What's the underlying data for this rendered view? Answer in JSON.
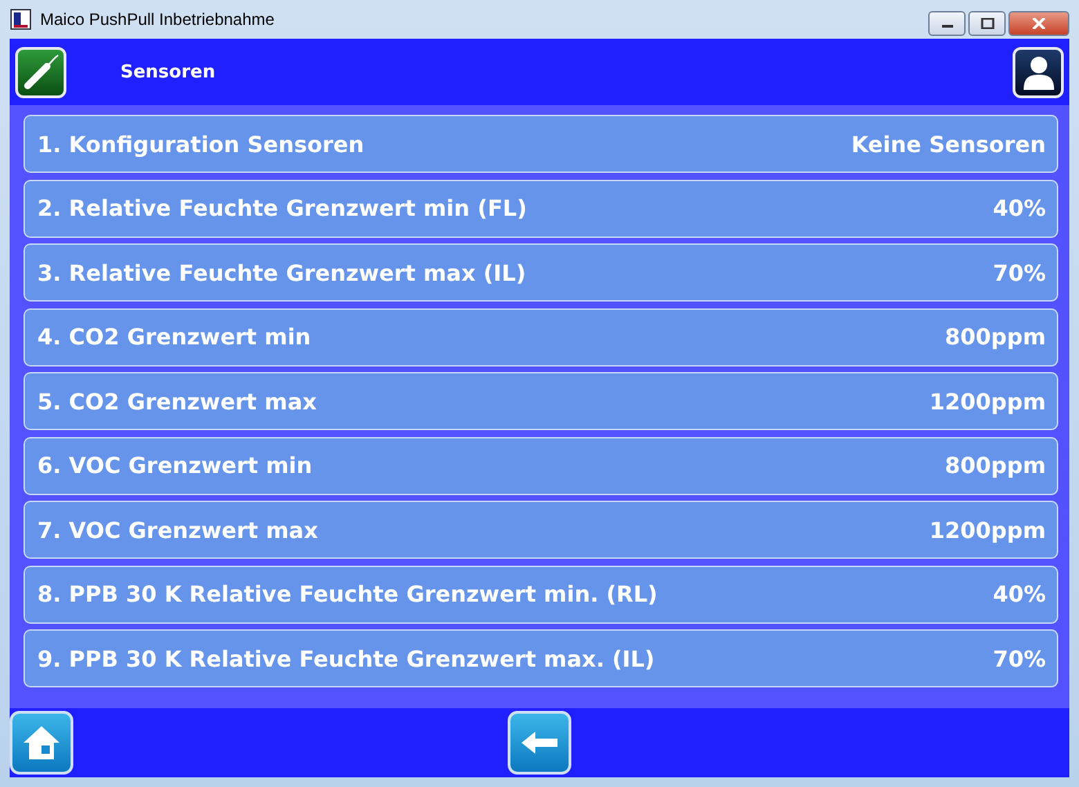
{
  "window": {
    "title": "Maico PushPull Inbetriebnahme"
  },
  "header": {
    "title": "Sensoren"
  },
  "rows": [
    {
      "label": "1. Konfiguration Sensoren",
      "value": "Keine Sensoren"
    },
    {
      "label": "2. Relative Feuchte Grenzwert min (FL)",
      "value": "40%"
    },
    {
      "label": "3. Relative Feuchte Grenzwert max (IL)",
      "value": "70%"
    },
    {
      "label": "4. CO2 Grenzwert min",
      "value": "800ppm"
    },
    {
      "label": "5. CO2 Grenzwert max",
      "value": "1200ppm"
    },
    {
      "label": "6. VOC Grenzwert min",
      "value": "800ppm"
    },
    {
      "label": "7. VOC Grenzwert max",
      "value": "1200ppm"
    },
    {
      "label": "8. PPB 30 K Relative Feuchte Grenzwert min. (RL)",
      "value": "40%"
    },
    {
      "label": "9. PPB 30 K Relative Feuchte Grenzwert max. (IL)",
      "value": "70%"
    }
  ]
}
